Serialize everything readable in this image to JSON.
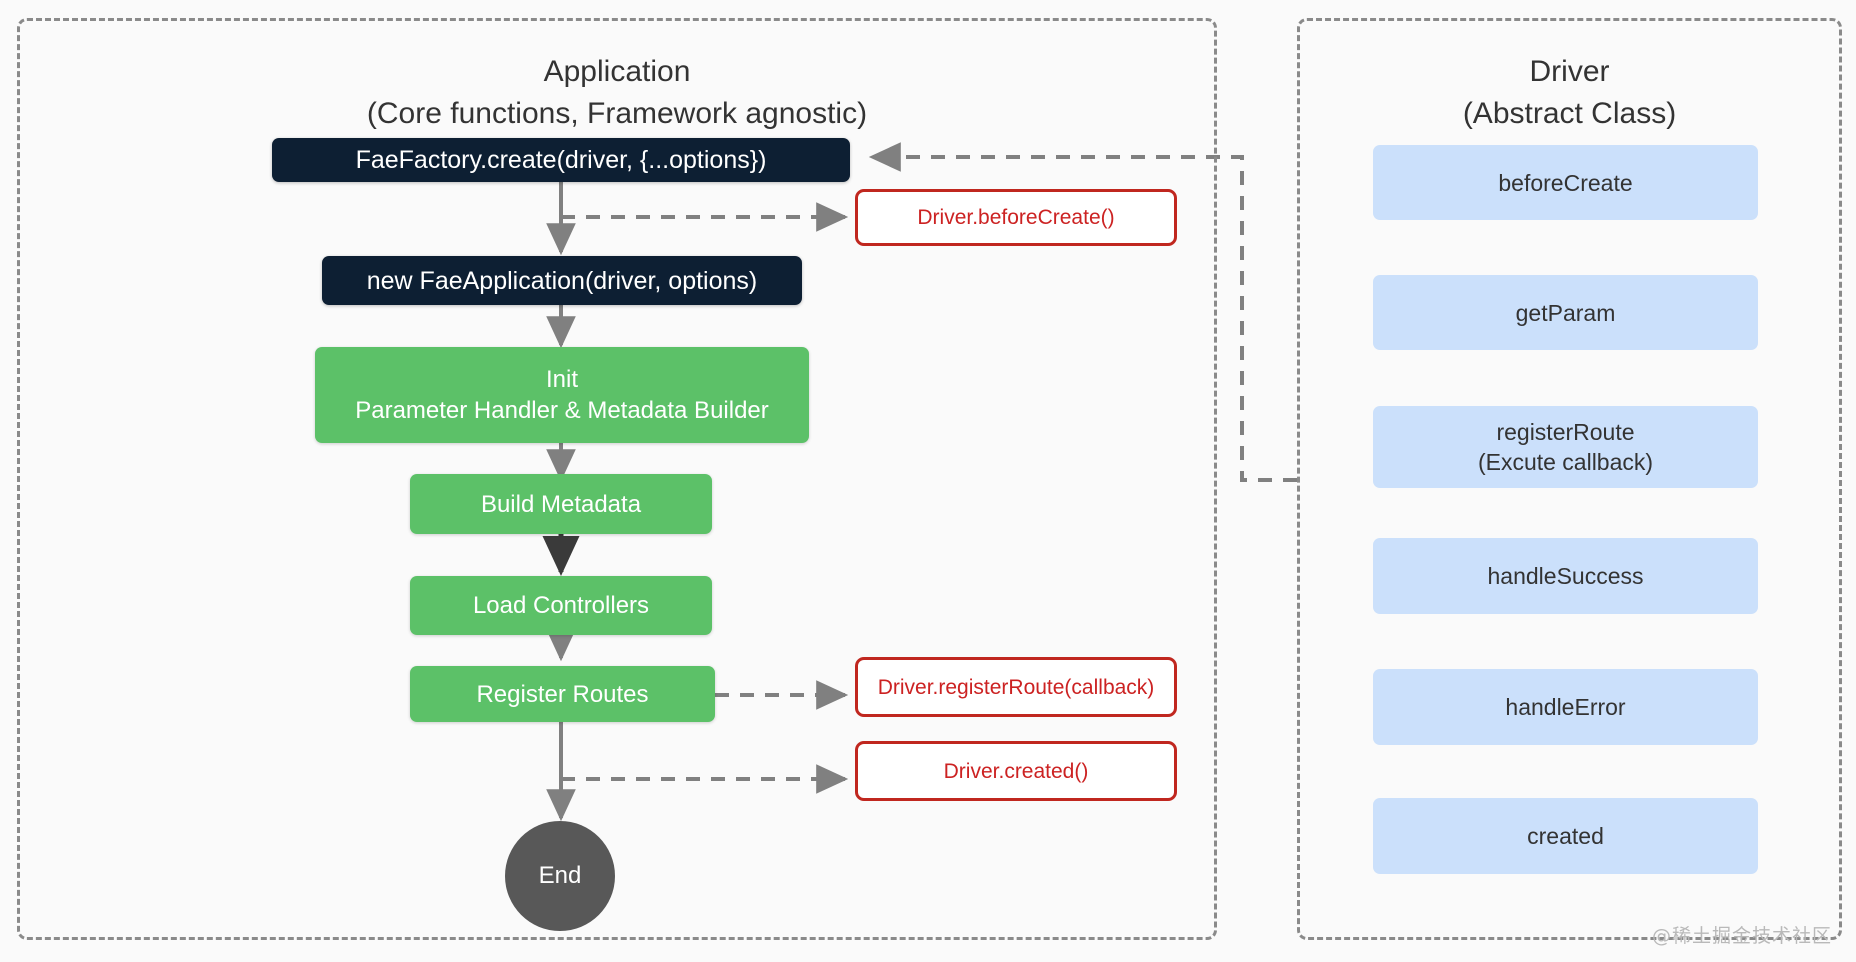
{
  "panels": {
    "application": {
      "title": "Application\n(Core functions, Framework agnostic)"
    },
    "driver": {
      "title": "Driver\n(Abstract Class)"
    }
  },
  "flow_nodes": [
    {
      "id": "fae-factory-create",
      "label": "FaeFactory.create(driver, {...options})",
      "kind": "dark"
    },
    {
      "id": "new-fae-application",
      "label": "new FaeApplication(driver, options)",
      "kind": "dark"
    },
    {
      "id": "init-parameter-handler",
      "label": "Init\nParameter Handler & Metadata Builder",
      "kind": "green"
    },
    {
      "id": "build-metadata",
      "label": "Build Metadata",
      "kind": "green"
    },
    {
      "id": "load-controllers",
      "label": "Load Controllers",
      "kind": "green"
    },
    {
      "id": "register-routes",
      "label": "Register Routes",
      "kind": "green"
    },
    {
      "id": "end",
      "label": "End",
      "kind": "end"
    }
  ],
  "hook_callouts": [
    {
      "id": "driver-before-create",
      "label": "Driver.beforeCreate()"
    },
    {
      "id": "driver-register-route",
      "label": "Driver.registerRoute(callback)"
    },
    {
      "id": "driver-created",
      "label": "Driver.created()"
    }
  ],
  "driver_methods": [
    {
      "id": "before-create",
      "label": "beforeCreate"
    },
    {
      "id": "get-param",
      "label": "getParam"
    },
    {
      "id": "register-route",
      "label": "registerRoute\n(Excute callback)"
    },
    {
      "id": "handle-success",
      "label": "handleSuccess"
    },
    {
      "id": "handle-error",
      "label": "handleError"
    },
    {
      "id": "created",
      "label": "created"
    }
  ],
  "watermark": "@稀土掘金技术社区",
  "colors": {
    "background": "#fafafa",
    "panel_border": "#8a8a8a",
    "dark_node": "#0d1f33",
    "green_node": "#5cc168",
    "red_node_border": "#c0271f",
    "red_node_text": "#cc2222",
    "blue_node": "#cbe0fb",
    "end_node": "#585858",
    "arrow_gray": "#808080",
    "arrow_dark": "#3a3a3a",
    "title_text": "#333333"
  }
}
